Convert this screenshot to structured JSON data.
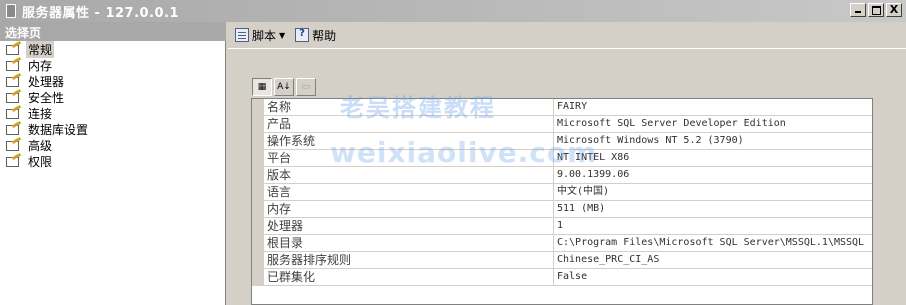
{
  "window": {
    "title": "服务器属性 - 127.0.0.1",
    "close_glyph": "X"
  },
  "left_panel": {
    "header": "选择页",
    "items": [
      {
        "label": "常规",
        "selected": true
      },
      {
        "label": "内存",
        "selected": false
      },
      {
        "label": "处理器",
        "selected": false
      },
      {
        "label": "安全性",
        "selected": false
      },
      {
        "label": "连接",
        "selected": false
      },
      {
        "label": "数据库设置",
        "selected": false
      },
      {
        "label": "高级",
        "selected": false
      },
      {
        "label": "权限",
        "selected": false
      }
    ]
  },
  "toolbar": {
    "script_label": "脚本",
    "help_label": "帮助"
  },
  "grid_toolbar": {
    "sort_glyph": "A↓"
  },
  "properties": [
    {
      "name": "名称",
      "value": "FAIRY"
    },
    {
      "name": "产品",
      "value": "Microsoft SQL Server Developer Edition"
    },
    {
      "name": "操作系统",
      "value": "Microsoft Windows NT 5.2 (3790)"
    },
    {
      "name": "平台",
      "value": "NT INTEL X86"
    },
    {
      "name": "版本",
      "value": "9.00.1399.06"
    },
    {
      "name": "语言",
      "value": "中文(中国)"
    },
    {
      "name": "内存",
      "value": "511 (MB)"
    },
    {
      "name": "处理器",
      "value": "1"
    },
    {
      "name": "根目录",
      "value": "C:\\Program Files\\Microsoft SQL Server\\MSSQL.1\\MSSQL"
    },
    {
      "name": "服务器排序规则",
      "value": "Chinese_PRC_CI_AS"
    },
    {
      "name": "已群集化",
      "value": "False"
    }
  ],
  "watermark": {
    "cn": "老吴搭建教程",
    "url": "weixiaolive.com"
  }
}
